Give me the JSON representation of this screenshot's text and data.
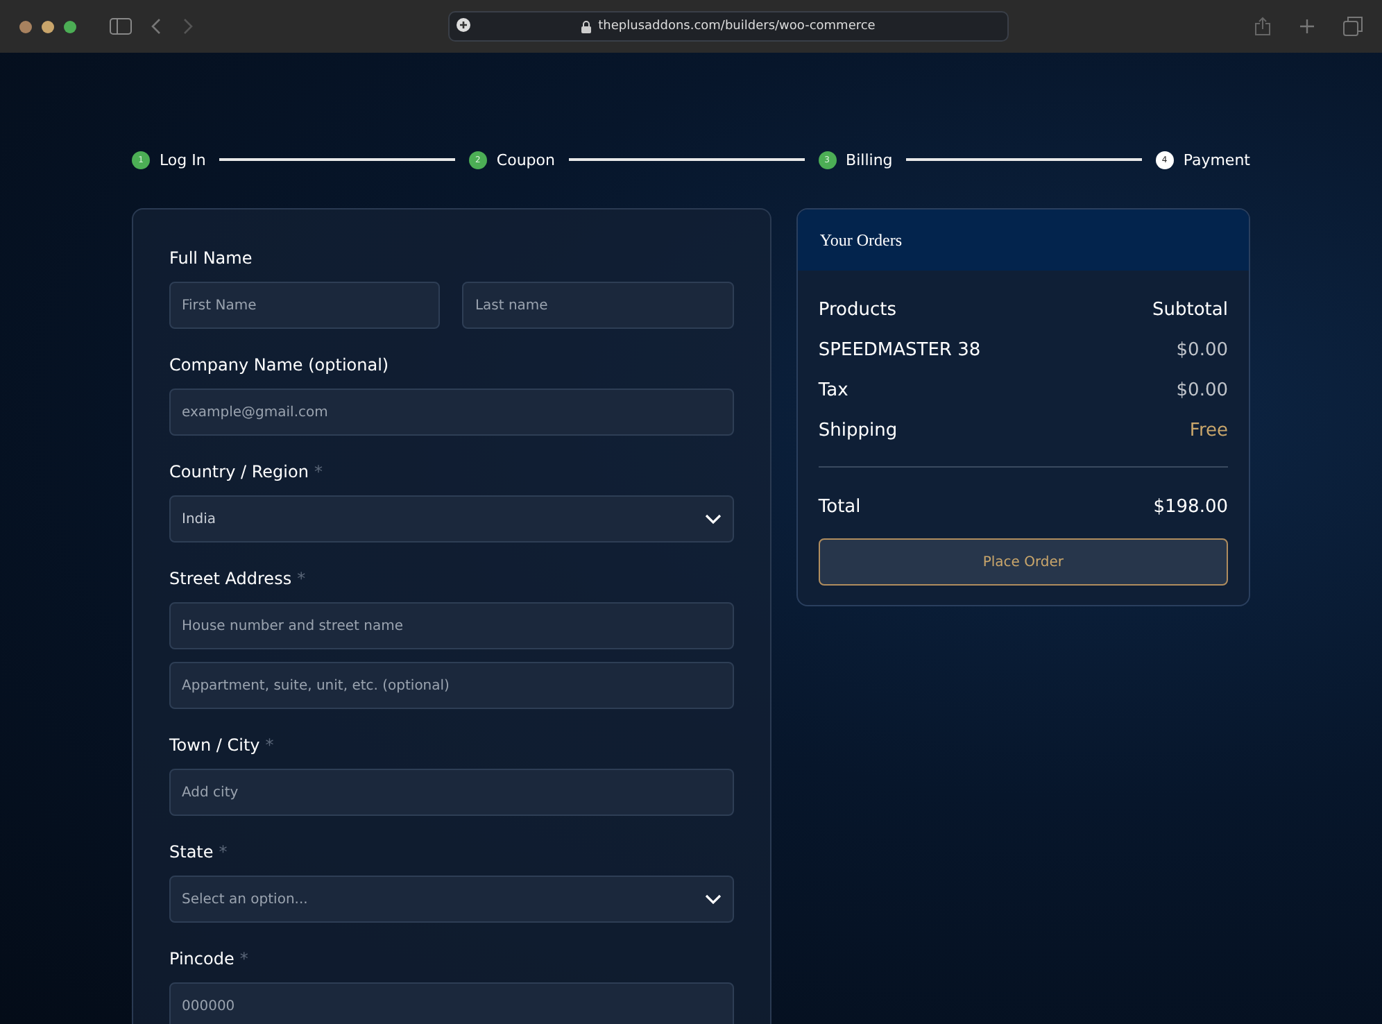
{
  "browser": {
    "url": "theplusaddons.com/builders/woo-commerce"
  },
  "steps": [
    {
      "number": "1",
      "label": "Log In",
      "done": true
    },
    {
      "number": "2",
      "label": "Coupon",
      "done": true
    },
    {
      "number": "3",
      "label": "Billing",
      "done": true
    },
    {
      "number": "4",
      "label": "Payment",
      "done": false
    }
  ],
  "form": {
    "groups": [
      {
        "label": "Full Name",
        "fields": [
          {
            "kind": "input",
            "placeholder": "First Name"
          },
          {
            "kind": "input",
            "placeholder": "Last name"
          }
        ]
      },
      {
        "label": "Company Name (optional)",
        "fields": [
          {
            "kind": "input",
            "placeholder": "example@gmail.com"
          }
        ]
      },
      {
        "label": "Country / Region",
        "mark": "*",
        "fields": [
          {
            "kind": "select",
            "value": "India"
          }
        ]
      },
      {
        "label": "Street Address",
        "mark": "*",
        "fields": [
          {
            "kind": "input",
            "placeholder": "House number and street name"
          },
          {
            "kind": "input",
            "placeholder": "Appartment, suite, unit, etc. (optional)"
          }
        ]
      },
      {
        "label": "Town / City",
        "mark": "*",
        "fields": [
          {
            "kind": "input",
            "placeholder": "Add city"
          }
        ]
      },
      {
        "label": "State",
        "mark": "*",
        "fields": [
          {
            "kind": "select",
            "placeholder": "Select an option..."
          }
        ]
      },
      {
        "label": "Pincode",
        "mark": "*",
        "fields": [
          {
            "kind": "input",
            "placeholder": "000000"
          }
        ]
      }
    ]
  },
  "orders": {
    "title": "Your Orders",
    "header": {
      "label": "Products",
      "value": "Subtotal"
    },
    "rows": [
      {
        "label": "SPEEDMASTER 38",
        "value": "$0.00",
        "kind": "amount"
      },
      {
        "label": "Tax",
        "value": "$0.00",
        "kind": "amount"
      },
      {
        "label": "Shipping",
        "value": "Free",
        "kind": "highlight"
      }
    ],
    "total": {
      "label": "Total",
      "value": "$198.00"
    },
    "button": "Place Order"
  }
}
